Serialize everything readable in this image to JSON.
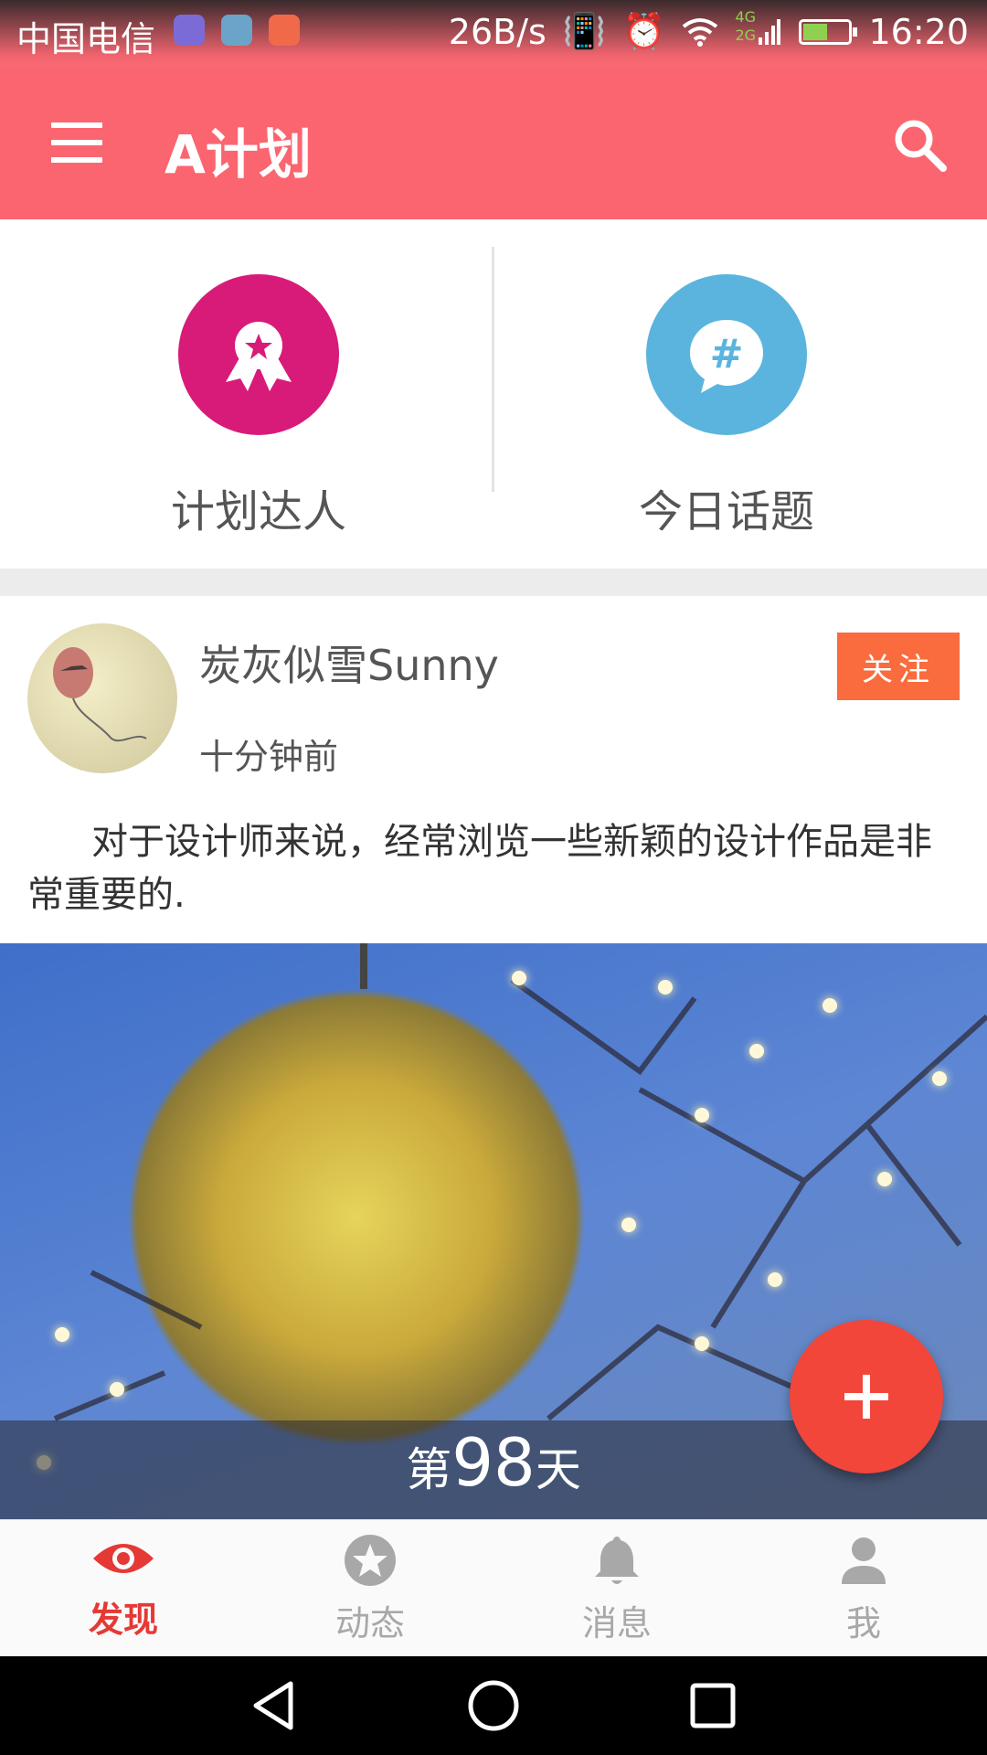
{
  "status_bar": {
    "carrier": "中国电信",
    "net_speed": "26B/s",
    "signal_type_top": "4G",
    "signal_type_bottom": "2G",
    "time": "16:20",
    "battery_level": 0.55
  },
  "app_bar": {
    "title": "A计划"
  },
  "quick_entries": [
    {
      "label": "计划达人",
      "color": "#d81b78",
      "icon": "medal-icon"
    },
    {
      "label": "今日话题",
      "color": "#5ab4de",
      "icon": "hashtag-chat-icon"
    }
  ],
  "post": {
    "author": "炭灰似雪Sunny",
    "time": "十分钟前",
    "follow_label": "关注",
    "content": "对于设计师来说，经常浏览一些新颖的设计作品是非常重要的.",
    "image_overlay": {
      "prefix": "第",
      "day": "98",
      "suffix": "天"
    }
  },
  "fab": {
    "icon": "plus-icon",
    "color": "#f2463a"
  },
  "bottom_nav": [
    {
      "label": "发现",
      "icon": "eye-icon",
      "active": true
    },
    {
      "label": "动态",
      "icon": "star-icon",
      "active": false
    },
    {
      "label": "消息",
      "icon": "bell-icon",
      "active": false
    },
    {
      "label": "我",
      "icon": "person-icon",
      "active": false
    }
  ],
  "colors": {
    "primary": "#fb6570",
    "accent": "#e53935",
    "follow": "#fa6b3d"
  }
}
